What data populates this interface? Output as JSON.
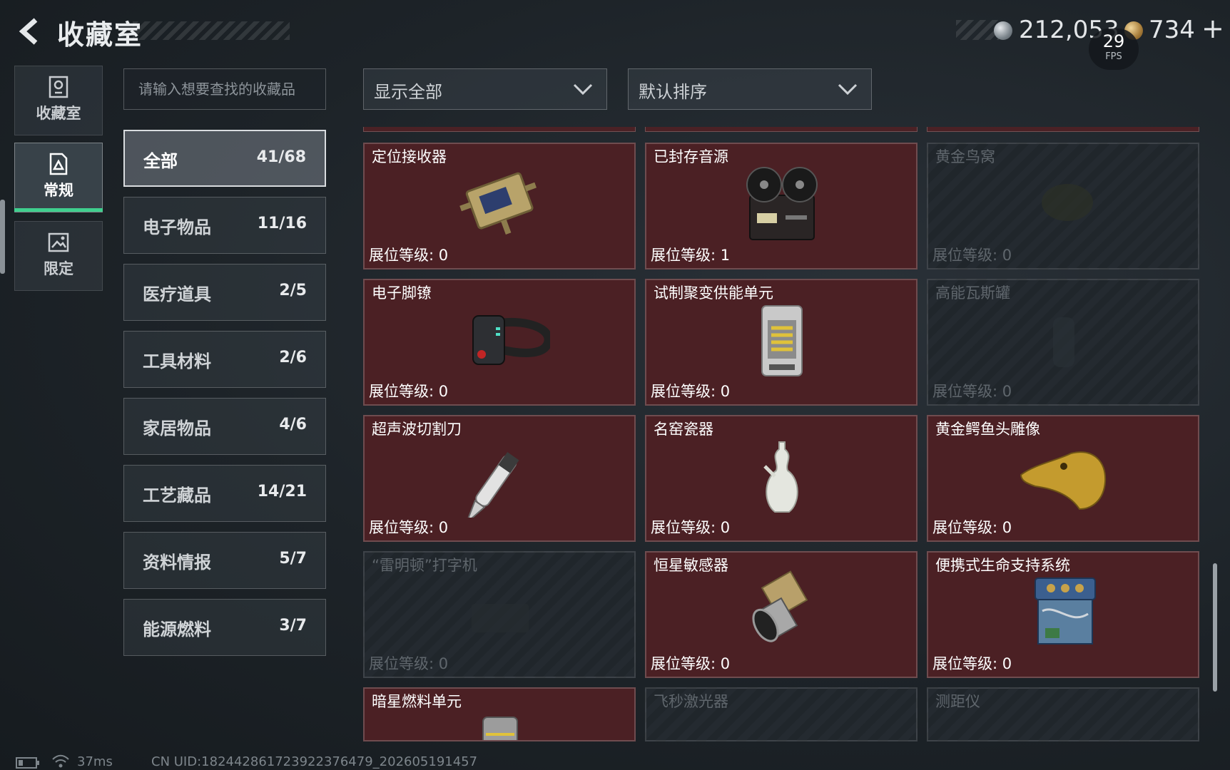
{
  "header": {
    "title": "收藏室",
    "currency_silver": "212,053",
    "currency_gold": "734",
    "add_symbol": "+"
  },
  "fps": {
    "value": "29",
    "label": "FPS"
  },
  "left_tabs": [
    {
      "label": "收藏室",
      "icon": "trophy-icon"
    },
    {
      "label": "常规",
      "icon": "document-icon",
      "selected": true
    },
    {
      "label": "限定",
      "icon": "picture-icon"
    }
  ],
  "search": {
    "placeholder": "请输入想要查找的收藏品",
    "value": ""
  },
  "filter": {
    "selected": "显示全部"
  },
  "sort": {
    "selected": "默认排序"
  },
  "categories": [
    {
      "name": "全部",
      "count": "41/68",
      "selected": true
    },
    {
      "name": "电子物品",
      "count": "11/16"
    },
    {
      "name": "医疗道具",
      "count": "2/5"
    },
    {
      "name": "工具材料",
      "count": "2/6"
    },
    {
      "name": "家居物品",
      "count": "4/6"
    },
    {
      "name": "工艺藏品",
      "count": "14/21"
    },
    {
      "name": "资料情报",
      "count": "5/7"
    },
    {
      "name": "能源燃料",
      "count": "3/7"
    }
  ],
  "level_label": "展位等级:",
  "items": [
    {
      "name": "定位接收器",
      "level": "0",
      "owned": true,
      "icon": "locator-receiver-icon"
    },
    {
      "name": "已封存音源",
      "level": "1",
      "owned": true,
      "icon": "reel-tape-recorder-icon"
    },
    {
      "name": "黄金鸟窝",
      "level": "0",
      "owned": false,
      "icon": "golden-nest-icon"
    },
    {
      "name": "电子脚镣",
      "level": "0",
      "owned": true,
      "icon": "electronic-ankle-monitor-icon"
    },
    {
      "name": "试制聚变供能单元",
      "level": "0",
      "owned": true,
      "icon": "fusion-power-unit-icon"
    },
    {
      "name": "高能瓦斯罐",
      "level": "0",
      "owned": false,
      "icon": "gas-canister-icon"
    },
    {
      "name": "超声波切割刀",
      "level": "0",
      "owned": true,
      "icon": "ultrasonic-cutter-icon"
    },
    {
      "name": "名窑瓷器",
      "level": "0",
      "owned": true,
      "icon": "porcelain-vase-icon"
    },
    {
      "name": "黄金鳄鱼头雕像",
      "level": "0",
      "owned": true,
      "icon": "golden-crocodile-head-icon"
    },
    {
      "name": "“雷明顿”打字机",
      "level": "0",
      "owned": false,
      "icon": "typewriter-icon"
    },
    {
      "name": "恒星敏感器",
      "level": "0",
      "owned": true,
      "icon": "star-sensor-icon"
    },
    {
      "name": "便携式生命支持系统",
      "level": "0",
      "owned": true,
      "icon": "life-support-system-icon"
    },
    {
      "name": "暗星燃料单元",
      "owned": true,
      "icon": "fuel-cell-icon"
    },
    {
      "name": "飞秒激光器",
      "owned": false,
      "icon": "laser-icon"
    },
    {
      "name": "测距仪",
      "owned": false,
      "icon": "rangefinder-icon"
    }
  ],
  "footer": {
    "ping": "37ms",
    "uid": "CN UID:182442861723922376479_202605191457"
  }
}
